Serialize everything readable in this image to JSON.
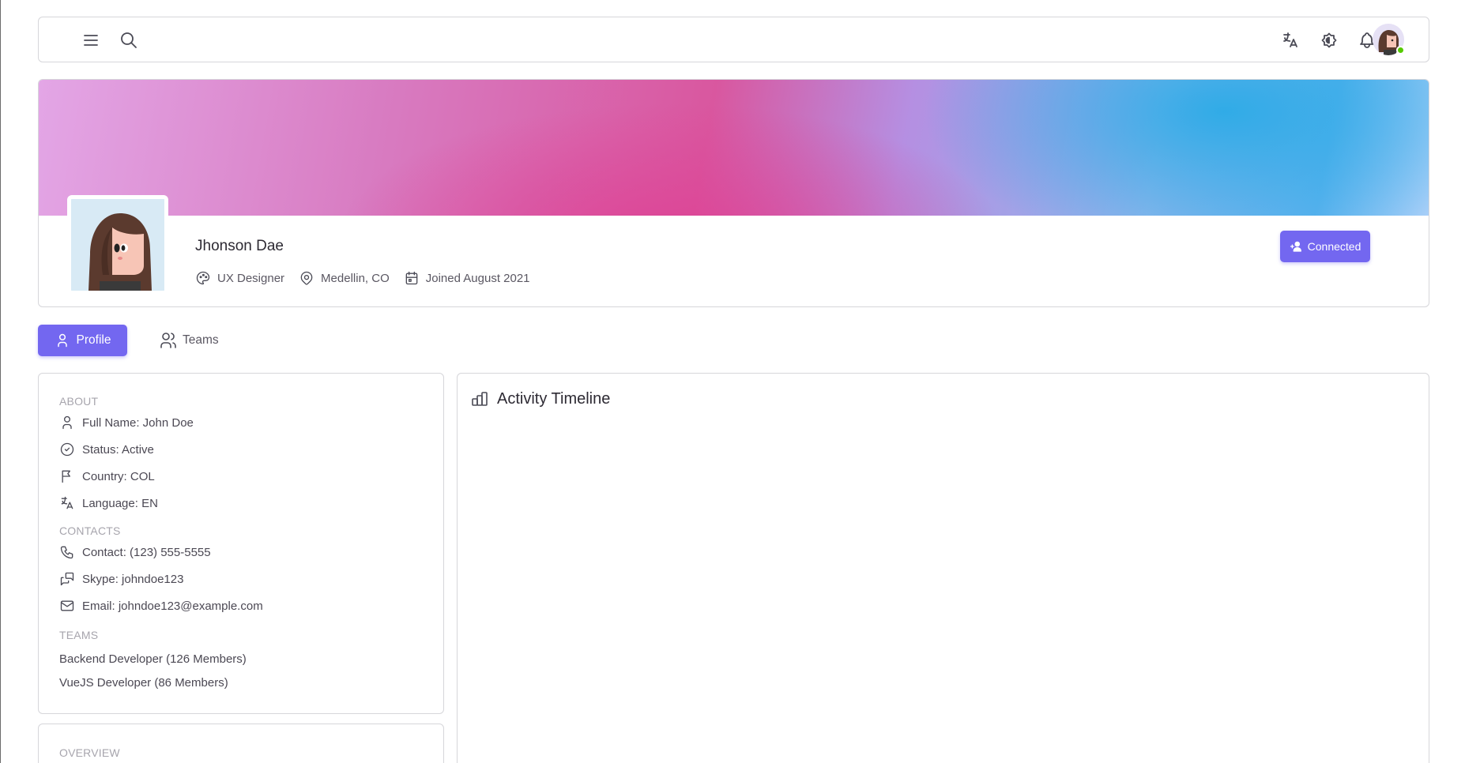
{
  "navbar": {
    "icons": [
      "menu-icon",
      "search-icon",
      "translate-icon",
      "theme-icon",
      "bell-icon"
    ],
    "avatar_status": "online"
  },
  "profile": {
    "name": "Jhonson Dae",
    "role": "UX Designer",
    "location": "Medellin, CO",
    "joined": "Joined August 2021",
    "connect_label": "Connected"
  },
  "tabs": {
    "profile": "Profile",
    "teams": "Teams"
  },
  "about": {
    "title": "ABOUT",
    "items": [
      {
        "icon": "user-icon",
        "text": "Full Name: John Doe"
      },
      {
        "icon": "check-circle-icon",
        "text": "Status: Active"
      },
      {
        "icon": "flag-icon",
        "text": "Country: COL"
      },
      {
        "icon": "translate-icon",
        "text": "Language: EN"
      }
    ]
  },
  "contacts": {
    "title": "CONTACTS",
    "items": [
      {
        "icon": "phone-icon",
        "text": "Contact: (123) 555-5555"
      },
      {
        "icon": "messages-icon",
        "text": "Skype: johndoe123"
      },
      {
        "icon": "mail-icon",
        "text": "Email: johndoe123@example.com"
      }
    ]
  },
  "teams": {
    "title": "TEAMS",
    "items": [
      "Backend Developer (126 Members)",
      "VueJS Developer (86 Members)"
    ]
  },
  "overview": {
    "title": "OVERVIEW"
  },
  "activity": {
    "title": "Activity Timeline"
  },
  "colors": {
    "primary": "#7367f0",
    "online": "#56ca00"
  }
}
